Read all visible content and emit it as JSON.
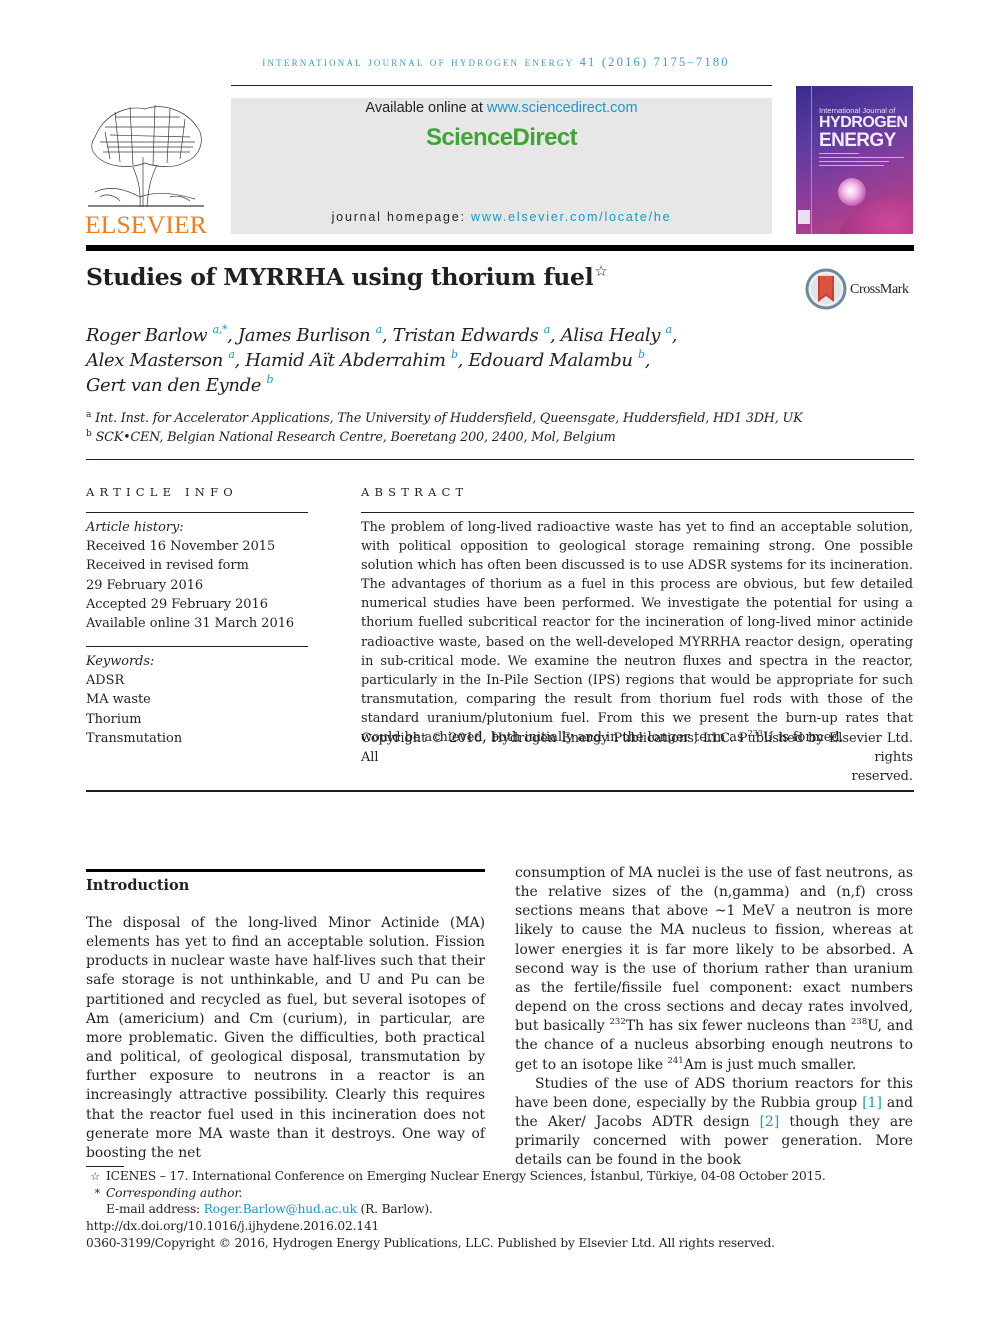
{
  "running_header": "International Journal of Hydrogen Energy 41 (2016) 7175–7180",
  "masthead": {
    "publisher": "ELSEVIER",
    "available_prefix": "Available online at ",
    "available_url": "www.sciencedirect.com",
    "brand": "ScienceDirect",
    "homepage_prefix": "journal homepage: ",
    "homepage_url": "www.elsevier.com/locate/he",
    "cover": {
      "line1": "International Journal of",
      "line2": "HYDROGEN",
      "line3": "ENERGY"
    },
    "crossmark_label": "CrossMark"
  },
  "article": {
    "title": "Studies of MYRRHA using thorium fuel",
    "title_note_mark": "☆",
    "authors_lines": [
      [
        {
          "name": "Roger Barlow",
          "sup": "a,*",
          "sep": ", "
        },
        {
          "name": "James Burlison",
          "sup": "a",
          "sep": ", "
        },
        {
          "name": "Tristan Edwards",
          "sup": "a",
          "sep": ", "
        },
        {
          "name": "Alisa Healy",
          "sup": "a",
          "sep": ","
        }
      ],
      [
        {
          "name": "Alex Masterson",
          "sup": "a",
          "sep": ", "
        },
        {
          "name": "Hamid Aït Abderrahim",
          "sup": "b",
          "sep": ", "
        },
        {
          "name": "Edouard Malambu",
          "sup": "b",
          "sep": ","
        }
      ],
      [
        {
          "name": "Gert van den Eynde",
          "sup": "b",
          "sep": ""
        }
      ]
    ],
    "affiliations": [
      {
        "mark": "a",
        "text": "Int. Inst. for Accelerator Applications, The University of Huddersfield, Queensgate, Huddersfield, HD1 3DH, UK"
      },
      {
        "mark": "b",
        "text": "SCK•CEN, Belgian National Research Centre, Boeretang 200, 2400, Mol, Belgium"
      }
    ]
  },
  "article_info": {
    "heading": "ARTICLE INFO",
    "history_label": "Article history:",
    "history": [
      "Received 16 November 2015",
      "Received in revised form",
      "29 February 2016",
      "Accepted 29 February 2016",
      "Available online 31 March 2016"
    ],
    "keywords_label": "Keywords:",
    "keywords": [
      "ADSR",
      "MA waste",
      "Thorium",
      "Transmutation"
    ]
  },
  "abstract": {
    "heading": "ABSTRACT",
    "text_before_sup": "The problem of long-lived radioactive waste has yet to find an acceptable solution, with political opposition to geological storage remaining strong. One possible solution which has often been discussed is to use ADSR systems for its incineration. The advantages of thorium as a fuel in this process are obvious, but few detailed numerical studies have been performed. We investigate the potential for using a thorium fuelled subcritical reactor for the incineration of long-lived minor actinide radioactive waste, based on the well-developed MYRRHA reactor design, operating in sub-critical mode. We examine the neutron fluxes and spectra in the reactor, particularly in the In-Pile Section (IPS) regions that would be appropriate for such transmutation, comparing the result from thorium fuel rods with those of the standard uranium/plutonium fuel. From this we present the burn-up rates that would be achieved, both initially and in the longer term as ",
    "sup": "233",
    "text_after_sup": "U is formed.",
    "copyright_line1": "Copyright © 2016, Hydrogen Energy Publications, LLC. Published by Elsevier Ltd. All rights",
    "copyright_line2": "reserved."
  },
  "body": {
    "section_heading": "Introduction",
    "left_paragraph": "The disposal of the long-lived Minor Actinide (MA) elements has yet to find an acceptable solution. Fission products in nuclear waste have half-lives such that their safe storage is not unthinkable, and U and Pu can be partitioned and recycled as fuel, but several isotopes of Am (americium) and Cm (curium), in particular, are more problematic. Given the difficulties, both practical and political, of geological disposal, transmutation by further exposure to neutrons in a reactor is an increasingly attractive possibility. Clearly this requires that the reactor fuel used in this incineration does not generate more MA waste than it destroys. One way of boosting the net",
    "right_p1": {
      "a": "consumption of MA nuclei is the use of fast neutrons, as the relative sizes of the (n,gamma) and (n,f) cross sections means that above ~1 MeV a neutron is more likely to cause the MA nucleus to fission, whereas at lower energies it is far more likely to be absorbed. A second way is the use of thorium rather than uranium as the fertile/fissile fuel component: exact numbers depend on the cross sections and decay rates involved, but basically ",
      "sup1": "232",
      "b": "Th has six fewer nucleons than ",
      "sup2": "238",
      "c": "U, and the chance of a nucleus absorbing enough neutrons to get to an isotope like ",
      "sup3": "241",
      "d": "Am is just much smaller."
    },
    "right_p2": {
      "a": "Studies of the use of ADS thorium reactors for this have been done, especially by the Rubbia group ",
      "ref1": "[1]",
      "b": " and the Aker/ Jacobs ADTR design ",
      "ref2": "[2]",
      "c": " though they are primarily concerned with power generation. More details can be found in the book"
    }
  },
  "footnotes": {
    "star_mark": "☆",
    "star_text": "ICENES – 17. International Conference on Emerging Nuclear Energy Sciences, İstanbul, Türkiye, 04-08 October 2015.",
    "corr_mark": "*",
    "corr_text": "Corresponding author.",
    "email_label": "E-mail address: ",
    "email": "Roger.Barlow@hud.ac.uk",
    "email_suffix": " (R. Barlow).",
    "doi": "http://dx.doi.org/10.1016/j.ijhydene.2016.02.141",
    "copyright": "0360-3199/Copyright © 2016, Hydrogen Energy Publications, LLC. Published by Elsevier Ltd. All rights reserved."
  }
}
